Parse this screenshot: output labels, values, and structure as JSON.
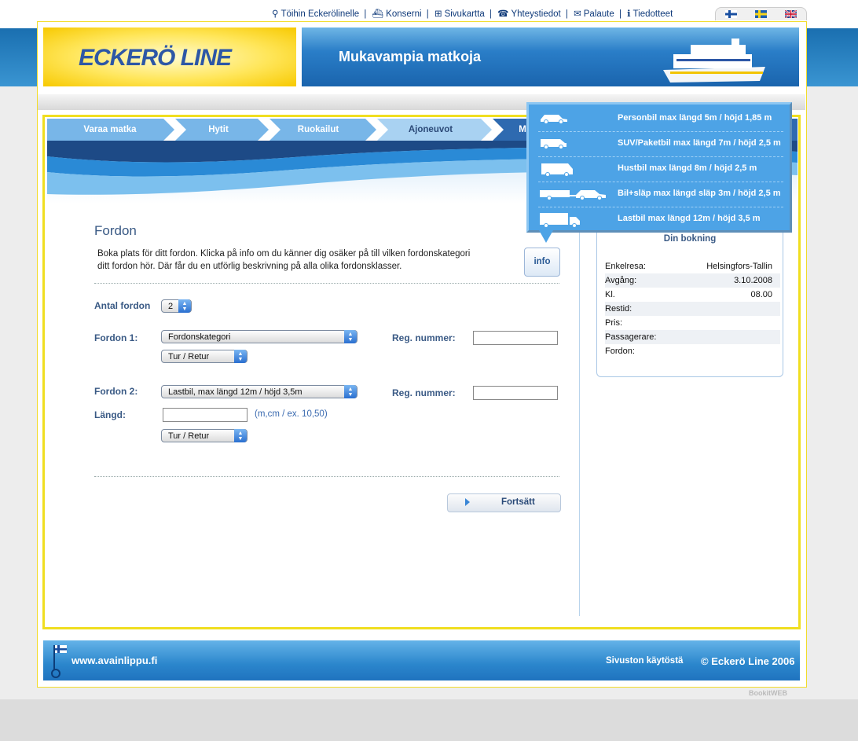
{
  "top_links": [
    "Töihin Eckerölinelle",
    "Konserni",
    "Sivukartta",
    "Yhteystiedot",
    "Palaute",
    "Tiedotteet"
  ],
  "logo_text": "ECKERÖ LINE",
  "banner_slogan": "Mukavampia matkoja",
  "steps": [
    "Varaa matka",
    "Hytit",
    "Ruokailut",
    "Ajoneuvot",
    "M"
  ],
  "heading": "Fordon",
  "intro_line1": "Boka plats för ditt fordon. Klicka på info om du känner dig osäker på till vilken fordonskategori",
  "intro_line2": "ditt fordon hör. Där får du en utförlig beskrivning på alla olika fordonsklasser.",
  "info_label": "info",
  "antal_label": "Antal fordon",
  "antal_value": "2",
  "vehicle1": {
    "label": "Fordon 1:",
    "category": "Fordonskategori",
    "trip": "Tur / Retur",
    "reg_label": "Reg. nummer:",
    "reg_value": ""
  },
  "vehicle2": {
    "label": "Fordon 2:",
    "category": "Lastbil, max längd 12m / höjd 3,5m",
    "trip": "Tur / Retur",
    "reg_label": "Reg. nummer:",
    "reg_value": "",
    "length_label": "Längd:",
    "length_value": "",
    "length_hint": "(m,cm / ex. 10,50)"
  },
  "continue_label": "Fortsätt",
  "booking": {
    "title": "Din bokning",
    "rows": [
      {
        "label": "Enkelresa:",
        "value": "Helsingfors-Tallin"
      },
      {
        "label": "Avgång:",
        "value": "3.10.2008"
      },
      {
        "label": "Kl.",
        "value": "08.00"
      },
      {
        "label": "Restid:",
        "value": ""
      },
      {
        "label": "Pris:",
        "value": ""
      },
      {
        "label": "Passagerare:",
        "value": ""
      },
      {
        "label": "Fordon:",
        "value": ""
      }
    ]
  },
  "popup_items": [
    {
      "icon": "car-icon",
      "text": "Personbil max längd 5m / höjd 1,85 m"
    },
    {
      "icon": "suv-icon",
      "text": "SUV/Paketbil max längd 7m / höjd 2,5 m"
    },
    {
      "icon": "camper-icon",
      "text": "Hustbil max längd 8m / höjd 2,5 m"
    },
    {
      "icon": "car-trailer-icon",
      "text": "Bil+släp max längd släp 3m / höjd 2,5 m"
    },
    {
      "icon": "truck-icon",
      "text": "Lastbil max längd 12m / höjd 3,5 m"
    }
  ],
  "footer": {
    "site": "www.avainlippu.fi",
    "terms": "Sivuston käytöstä",
    "copyright": "© Eckerö Line 2006"
  },
  "powered_by": "BookitWEB",
  "colors": {
    "accent_yellow": "#f0de20",
    "brand_blue": "#2d57a6",
    "popup_blue": "#4da3e6"
  }
}
